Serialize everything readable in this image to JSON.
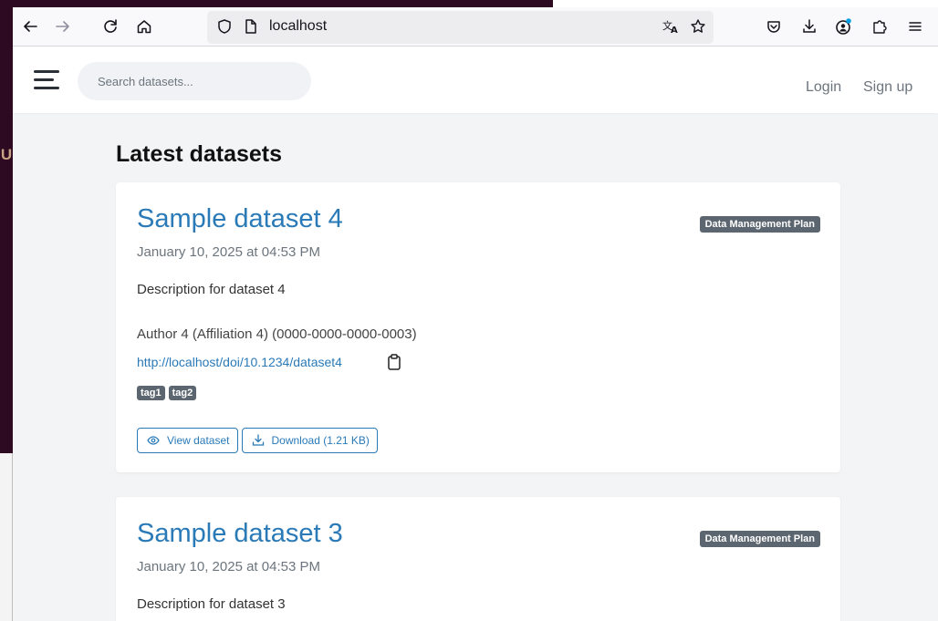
{
  "browser": {
    "url": "localhost",
    "icons": [
      "back-arrow-icon",
      "forward-arrow-icon",
      "reload-icon",
      "home-icon",
      "shield-icon",
      "page-icon",
      "translate-icon",
      "star-icon",
      "pocket-icon",
      "download-icon",
      "account-icon",
      "extensions-icon",
      "menu-icon"
    ]
  },
  "desktop": {
    "edge_letter": "U"
  },
  "header": {
    "search_placeholder": "Search datasets...",
    "login_label": "Login",
    "signup_label": "Sign up"
  },
  "main": {
    "title_bold": "Latest",
    "title_rest": "datasets",
    "datasets": [
      {
        "title": "Sample dataset 4",
        "badge": "Data Management Plan",
        "date": "January 10, 2025 at 04:53 PM",
        "description": "Description for dataset 4",
        "author": "Author 4 (Affiliation 4) (0000-0000-0000-0003)",
        "doi": "http://localhost/doi/10.1234/dataset4",
        "tags": [
          "tag1",
          "tag2"
        ],
        "view_label": "View dataset",
        "download_label": "Download (1.21 KB)"
      },
      {
        "title": "Sample dataset 3",
        "badge": "Data Management Plan",
        "date": "January 10, 2025 at 04:53 PM",
        "description": "Description for dataset 3"
      }
    ]
  },
  "colors": {
    "link": "#2a7ab8",
    "badge": "#5c6670",
    "page_bg": "#f3f4f6",
    "desktop_bg": "#2d0922"
  }
}
